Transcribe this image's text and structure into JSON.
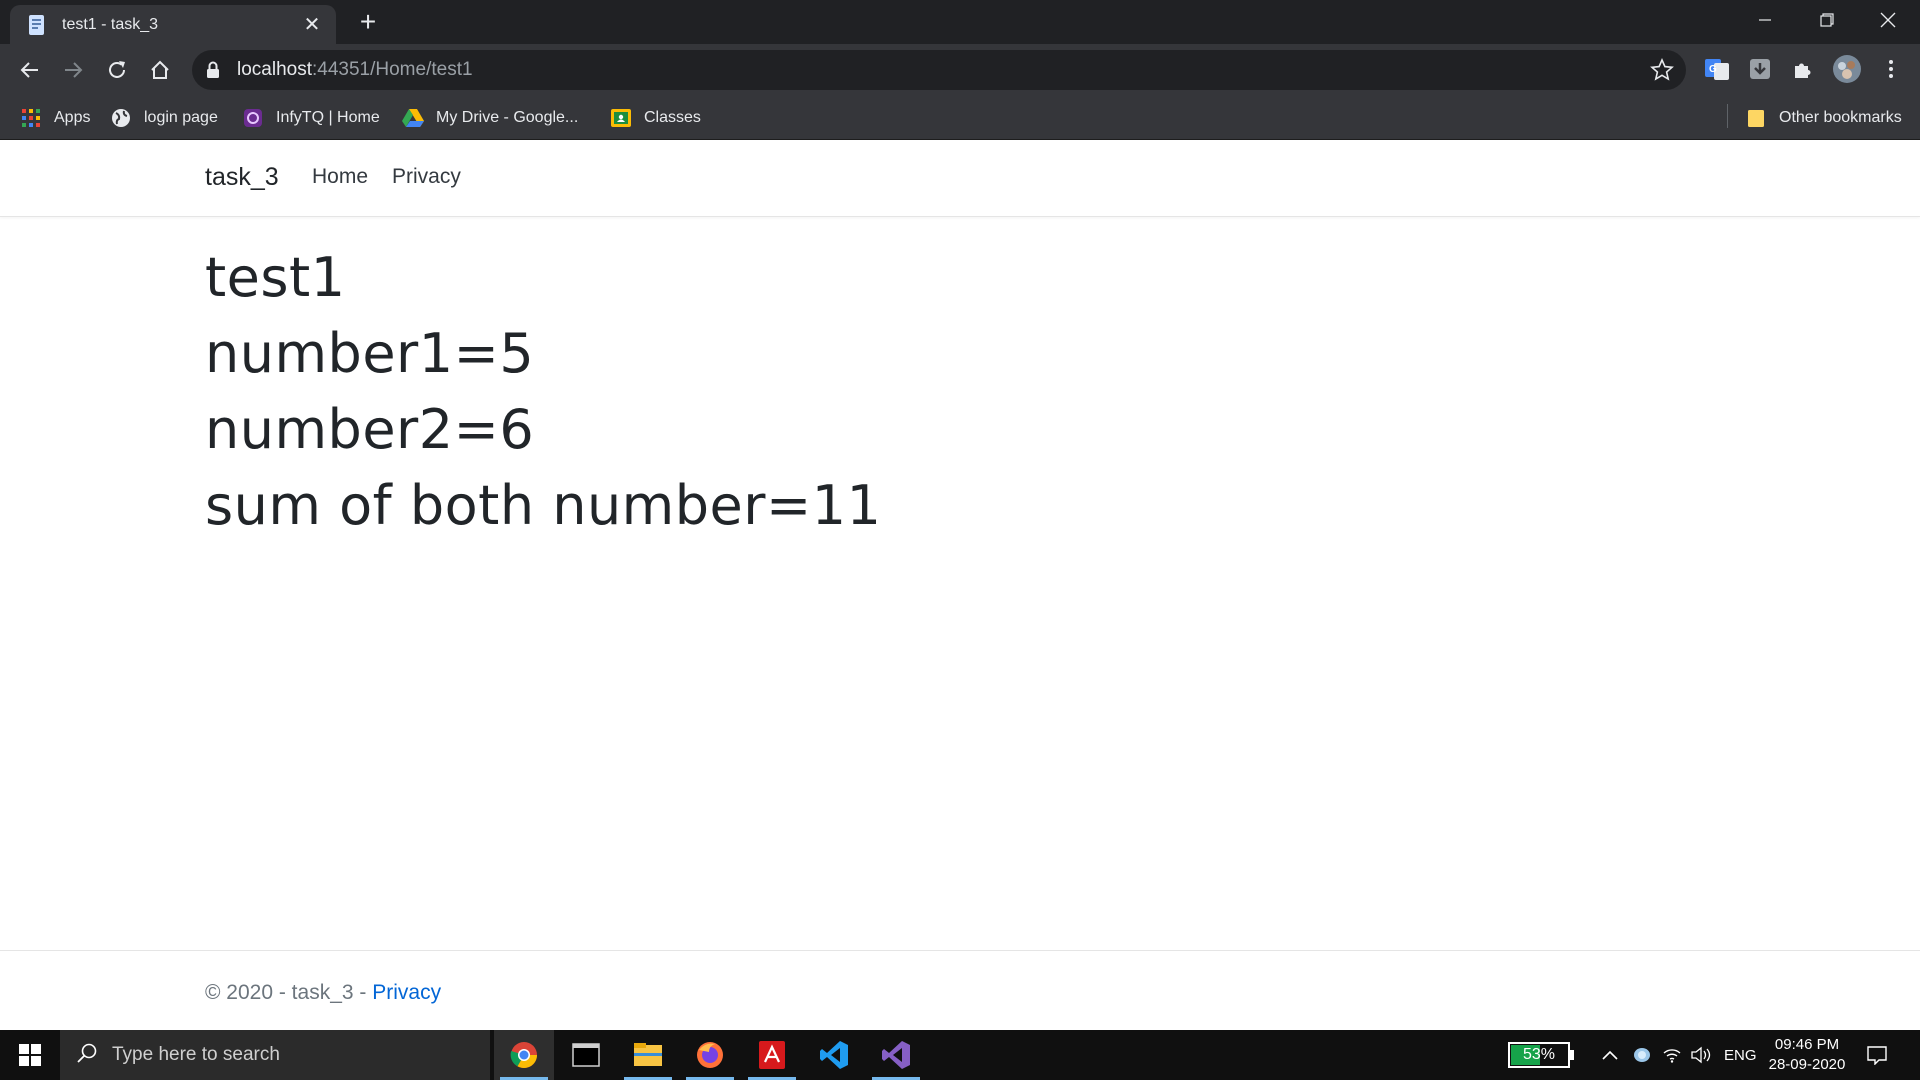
{
  "browser": {
    "tab_title": "test1 - task_3",
    "new_tab": "+",
    "close_tab": "✕",
    "url_host": "localhost",
    "url_rest": ":44351/Home/test1",
    "bookmarks": [
      {
        "label": "Apps",
        "icon": "apps-grid-icon"
      },
      {
        "label": "login page",
        "icon": "globe-icon"
      },
      {
        "label": "InfyTQ | Home",
        "icon": "infytq-icon"
      },
      {
        "label": "My Drive - Google...",
        "icon": "google-drive-icon"
      },
      {
        "label": "Classes",
        "icon": "google-classroom-icon"
      }
    ],
    "other_bookmarks": "Other bookmarks"
  },
  "site": {
    "brand": "task_3",
    "nav": {
      "home": "Home",
      "privacy": "Privacy"
    }
  },
  "main": {
    "heading": "test1",
    "number1": "number1=5",
    "number2": "number2=6",
    "sum": "sum of both number=11"
  },
  "footer": {
    "copyright": "© 2020 - task_3 - ",
    "privacy_link": "Privacy"
  },
  "taskbar": {
    "search_placeholder": "Type here to search",
    "battery_percent": "53%",
    "battery_level": 0.53,
    "language": "ENG",
    "time": "09:46 PM",
    "date": "28-09-2020"
  },
  "colors": {
    "chrome_dark": "#202124",
    "chrome_toolbar": "#35363a",
    "link_blue": "#0366d6",
    "battery_green": "#16a34a"
  }
}
